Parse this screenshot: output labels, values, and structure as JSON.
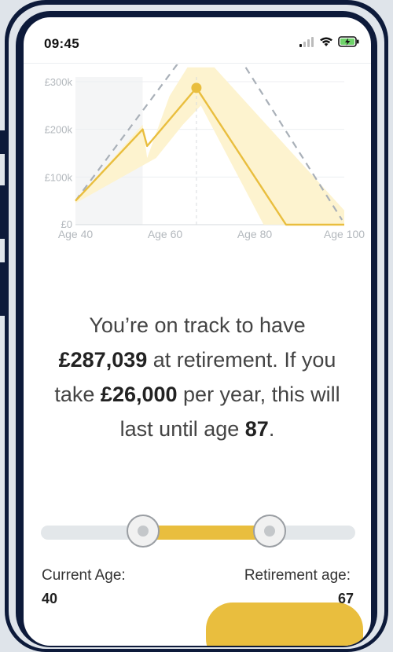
{
  "status_bar": {
    "time": "09:45"
  },
  "chart_data": {
    "type": "line",
    "x": [
      40,
      55,
      56,
      67,
      87,
      100
    ],
    "series": [
      {
        "values": [
          50000,
          200000,
          165000,
          287039,
          0,
          0
        ]
      }
    ],
    "xlabel": "",
    "ylabel": "",
    "ylim": [
      0,
      300000
    ],
    "xlim": [
      40,
      100
    ],
    "y_ticks": [
      "£0",
      "£100k",
      "£200k",
      "£300k"
    ],
    "x_ticks": [
      "Age 40",
      "Age 60",
      "Age 80",
      "Age 100"
    ],
    "highlight": {
      "x": 67,
      "y": 287039
    },
    "grid": true,
    "colors": {
      "line": "#e9be3e",
      "band": "#fdf3cf",
      "dashed": "#a9b0b8"
    }
  },
  "summary": {
    "p1": "You’re on track to have",
    "amount": "£287,039",
    "p2": " at retirement. If you take ",
    "yearly": "£26,000",
    "p3": " per year, this will last until age ",
    "age": "87",
    "p4": "."
  },
  "ages": {
    "current_label": "Current Age:",
    "current_value": "40",
    "retirement_label": "Retirement age:",
    "retirement_value": "67"
  },
  "colors": {
    "accent": "#e9be3e",
    "frame": "#0d1a3a"
  }
}
